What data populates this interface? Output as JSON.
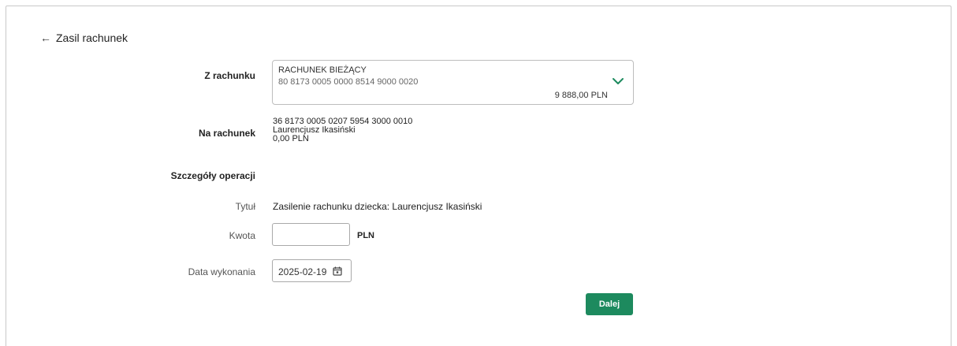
{
  "header": {
    "back_icon": "arrow-left-icon",
    "title": "Zasil rachunek"
  },
  "from_account": {
    "label": "Z rachunku",
    "name": "RACHUNEK BIEŻĄCY",
    "number": "80 8173 0005 0000 8514 9000 0020",
    "balance": "9 888,00 PLN",
    "dropdown_icon": "chevron-down-icon",
    "accent_color": "#1d8a5e"
  },
  "to_account": {
    "label": "Na rachunek",
    "number": "36 8173 0005 0207 5954 3000 0010",
    "owner": "Laurencjusz Ikasiński",
    "balance": "0,00 PLN"
  },
  "details": {
    "section_label": "Szczegóły operacji",
    "title_label": "Tytuł",
    "title_value": "Zasilenie rachunku dziecka: Laurencjusz Ikasiński",
    "amount_label": "Kwota",
    "amount_value": "",
    "currency": "PLN",
    "date_label": "Data wykonania",
    "date_value": "2025-02-19",
    "calendar_icon": "calendar-icon"
  },
  "actions": {
    "next_label": "Dalej",
    "button_color": "#1d8a5e"
  }
}
